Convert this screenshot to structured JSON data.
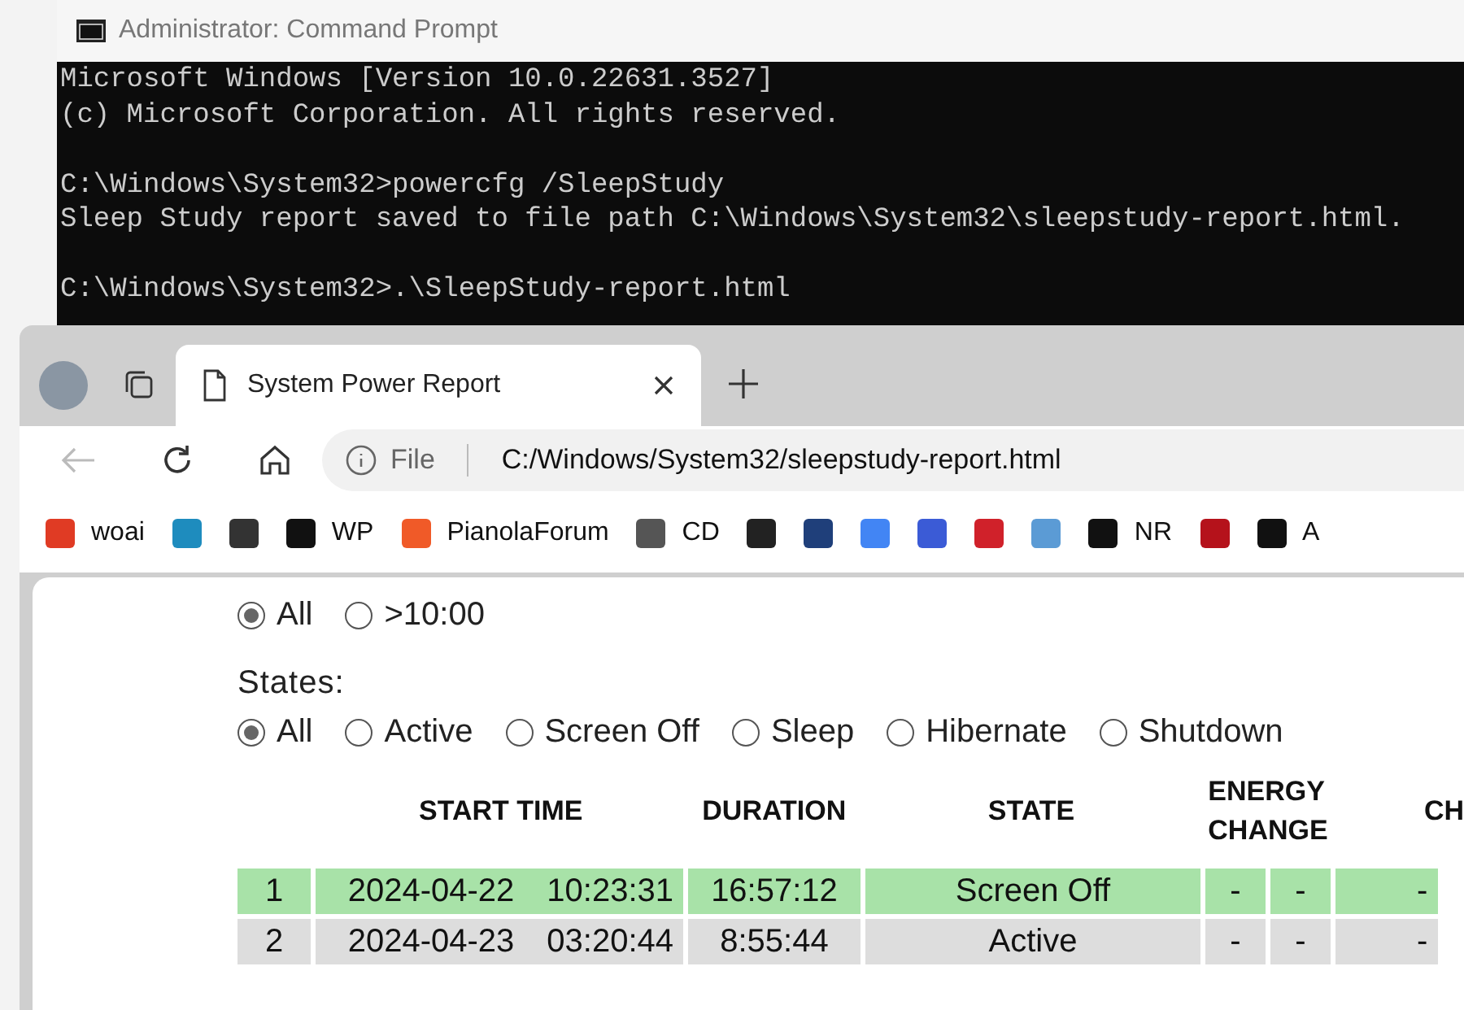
{
  "console": {
    "title": "Administrator: Command Prompt",
    "blocks": [
      [
        "Microsoft Windows [Version 10.0.22631.3527]",
        "(c) Microsoft Corporation. All rights reserved."
      ],
      [
        "C:\\Windows\\System32>powercfg /SleepStudy",
        "Sleep Study report saved to file path C:\\Windows\\System32\\sleepstudy-report.html."
      ],
      [
        "C:\\Windows\\System32>.\\SleepStudy-report.html"
      ]
    ]
  },
  "browser": {
    "tab": {
      "title": "System Power Report",
      "selected": true
    },
    "address": {
      "scheme": "File",
      "url": "C:/Windows/System32/sleepstudy-report.html"
    },
    "bookmarks": [
      {
        "label": "woai",
        "color": "#e03b24"
      },
      {
        "color": "#1e8cbe"
      },
      {
        "color": "#333333"
      },
      {
        "label": "WP",
        "color": "#111111"
      },
      {
        "label": "PianolaForum",
        "color": "#f05a28"
      },
      {
        "label": "CD",
        "color": "#555555"
      },
      {
        "color": "#222222"
      },
      {
        "color": "#1f3f7a"
      },
      {
        "color": "#4285f4"
      },
      {
        "color": "#3b5bd6"
      },
      {
        "color": "#d0212a"
      },
      {
        "color": "#5b9bd5"
      },
      {
        "label": "NR",
        "color": "#111111"
      },
      {
        "color": "#b5121b"
      },
      {
        "label": "A",
        "color": "#111111"
      }
    ]
  },
  "report": {
    "session_length": [
      {
        "label": "All",
        "selected": true
      },
      {
        "label": ">10:00",
        "selected": false
      }
    ],
    "states_label": "States:",
    "states": [
      {
        "label": "All",
        "selected": true
      },
      {
        "label": "Active",
        "selected": false
      },
      {
        "label": "Screen Off",
        "selected": false
      },
      {
        "label": "Sleep",
        "selected": false
      },
      {
        "label": "Hibernate",
        "selected": false
      },
      {
        "label": "Shutdown",
        "selected": false
      }
    ],
    "table": {
      "columns": [
        "START TIME",
        "DURATION",
        "STATE",
        "ENERGY CHANGE",
        "CH"
      ],
      "rows": [
        {
          "index": "1",
          "date": "2024-04-22",
          "time": "10:23:31",
          "duration": "16:57:12",
          "state": "Screen Off",
          "cells": [
            "-",
            "-",
            "-"
          ],
          "color": "#a8e2a8"
        },
        {
          "index": "2",
          "date": "2024-04-23",
          "time": "03:20:44",
          "duration": "8:55:44",
          "state": "Active",
          "cells": [
            "-",
            "-",
            "-"
          ],
          "color": "#dddddd"
        }
      ]
    }
  }
}
